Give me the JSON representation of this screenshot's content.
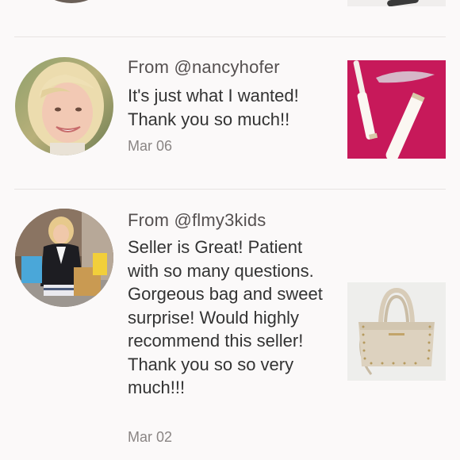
{
  "reviews": [
    {
      "from_label": "From @nancyhofer",
      "message": "It's just what I wanted! Thank you so much!!",
      "date": "Mar 06",
      "avatar_icon": "user-avatar-photo",
      "thumbnail_icon": "mascara-product-photo"
    },
    {
      "from_label": "From @flmy3kids",
      "message": "Seller is Great! Patient with so many questions. Gorgeous bag and sweet surprise! Would highly recommend this seller! Thank you so so very much!!!",
      "date": "Mar 02",
      "avatar_icon": "user-avatar-photo",
      "thumbnail_icon": "handbag-product-photo"
    }
  ],
  "colors": {
    "background": "#fbf9f9",
    "divider": "#e7e3e2",
    "from_text": "#555050",
    "message_text": "#333333",
    "date_text": "#8a8584",
    "thumb1_bg": "#c7195a"
  }
}
